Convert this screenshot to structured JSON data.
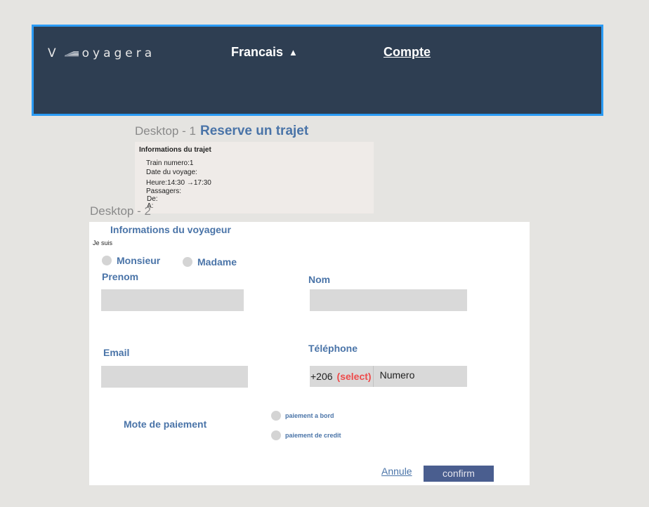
{
  "header": {
    "logo_letter": "V",
    "logo_text": "oyagera",
    "language_label": "Francais",
    "language_arrow": "▲",
    "account_label": "Compte",
    "border_color": "#2b9bf4",
    "bg_color": "#2e3e52"
  },
  "desktop1": {
    "frame_label": "Desktop - 1",
    "title": "Reserve un trajet",
    "trip": {
      "heading": "Informations du trajet",
      "train_number": "Train numero:1",
      "travel_date": "Date du voyage:",
      "time": "Heure:14:30 →17:30",
      "passengers": "Passagers:",
      "from": "De:",
      "to": "A:"
    }
  },
  "desktop2": {
    "frame_label": "Desktop - 2",
    "title": "Informations du voyageur",
    "je_suis": "Je suis",
    "civility_options": [
      "Monsieur",
      "Madame"
    ],
    "labels": {
      "first_name": "Prenom",
      "last_name": "Nom",
      "email": "Email",
      "phone": "Téléphone"
    },
    "phone": {
      "code": "+206",
      "select": "(select)",
      "number_placeholder": "Numero"
    },
    "payment": {
      "title": "Mote de paiement",
      "options": [
        "paiement a bord",
        "paiement de credit"
      ]
    },
    "actions": {
      "cancel": "Annule",
      "confirm": "confirm"
    }
  },
  "colors": {
    "accent_blue": "#4a74a8",
    "confirm_bg": "#4a5e8f",
    "select_red": "#ee4b4b",
    "input_gray": "#d9d9d9"
  }
}
